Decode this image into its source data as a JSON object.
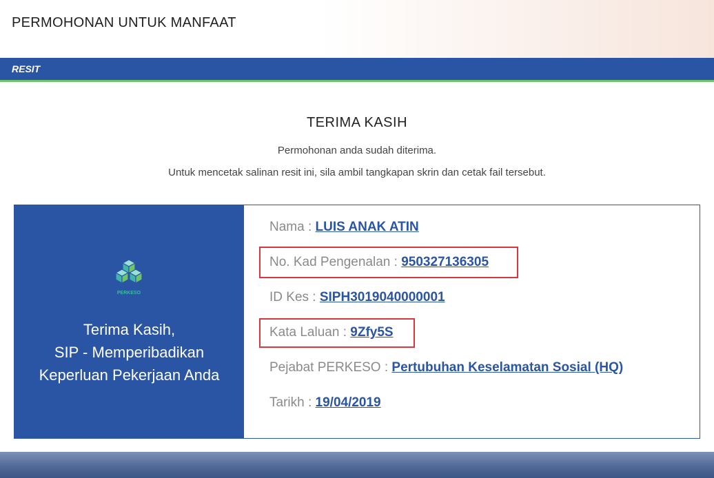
{
  "header": {
    "title": "PERMOHONAN UNTUK MANFAAT"
  },
  "section_bar": {
    "label": "RESIT"
  },
  "confirmation": {
    "title": "TERIMA KASIH",
    "line1": "Permohonan anda sudah diterima.",
    "line2": "Untuk mencetak salinan resit ini, sila ambil tangkapan skrin dan cetak fail tersebut."
  },
  "card": {
    "logo_text": "PERKESO",
    "left_lines": [
      "Terima Kasih,",
      "SIP - Memperibadikan",
      "Keperluan Pekerjaan Anda"
    ],
    "fields": {
      "nama": {
        "label": "Nama : ",
        "value": "LUIS ANAK ATIN"
      },
      "ic": {
        "label": "No. Kad Pengenalan : ",
        "value": "950327136305"
      },
      "case_id": {
        "label": "ID Kes : ",
        "value": "SIPH3019040000001"
      },
      "password": {
        "label": "Kata Laluan : ",
        "value": "9Zfy5S"
      },
      "office": {
        "label": "Pejabat PERKESO : ",
        "value": "Pertubuhan Keselamatan Sosial (HQ)"
      },
      "date": {
        "label": "Tarikh : ",
        "value": "19/04/2019"
      }
    }
  },
  "colors": {
    "primary_blue": "#2a55a4",
    "accent_green": "#6fc36a",
    "highlight_red": "#d9373f"
  }
}
